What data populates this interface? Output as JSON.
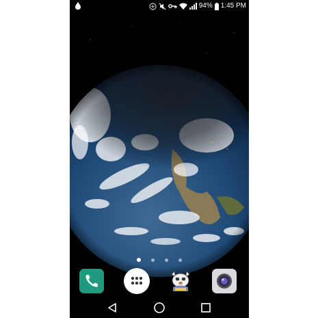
{
  "status_bar": {
    "left_icon": "water-drop-icon",
    "icons": [
      "data-saver-icon",
      "mute-icon",
      "vpn-key-icon",
      "wifi-icon",
      "signal-icon",
      "battery-icon"
    ],
    "battery_percent": "94%",
    "time": "1:45 PM"
  },
  "wallpaper": {
    "description_icon": "earth-wallpaper"
  },
  "home": {
    "page_count": 4,
    "active_page": 1
  },
  "dock": {
    "apps": [
      "phone-app-icon",
      "app-drawer-icon",
      "avatar-app-icon",
      "camera-app-icon"
    ]
  },
  "nav_bar": {
    "buttons": [
      "back-icon",
      "home-icon",
      "recents-icon"
    ]
  }
}
